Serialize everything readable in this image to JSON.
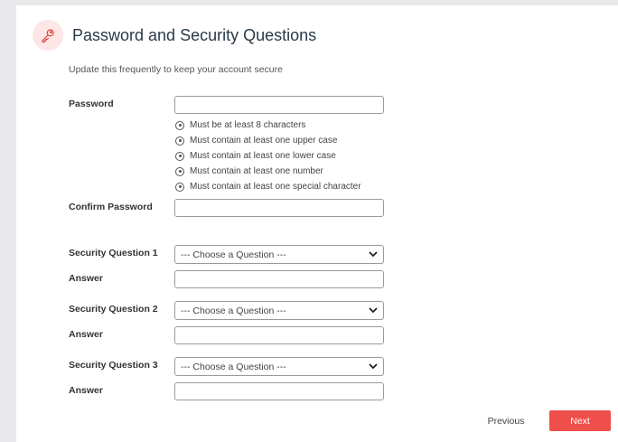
{
  "header": {
    "icon": "key-icon",
    "title": "Password and Security Questions",
    "subtitle": "Update this frequently to keep your account secure"
  },
  "password": {
    "label": "Password",
    "requirements": [
      "Must be at least 8 characters",
      "Must contain at least one upper case",
      "Must contain at least one lower case",
      "Must contain at least one number",
      "Must contain at least one special character"
    ]
  },
  "confirm_password": {
    "label": "Confirm Password"
  },
  "security_questions": [
    {
      "label": "Security Question 1",
      "selected": "--- Choose a Question ---",
      "answer_label": "Answer"
    },
    {
      "label": "Security Question 2",
      "selected": "--- Choose a Question ---",
      "answer_label": "Answer"
    },
    {
      "label": "Security Question 3",
      "selected": "--- Choose a Question ---",
      "answer_label": "Answer"
    }
  ],
  "buttons": {
    "previous": "Previous",
    "next": "Next"
  },
  "colors": {
    "accent": "#ef4f4a",
    "icon_bg": "#fde6e6",
    "title": "#2b3a4a"
  }
}
